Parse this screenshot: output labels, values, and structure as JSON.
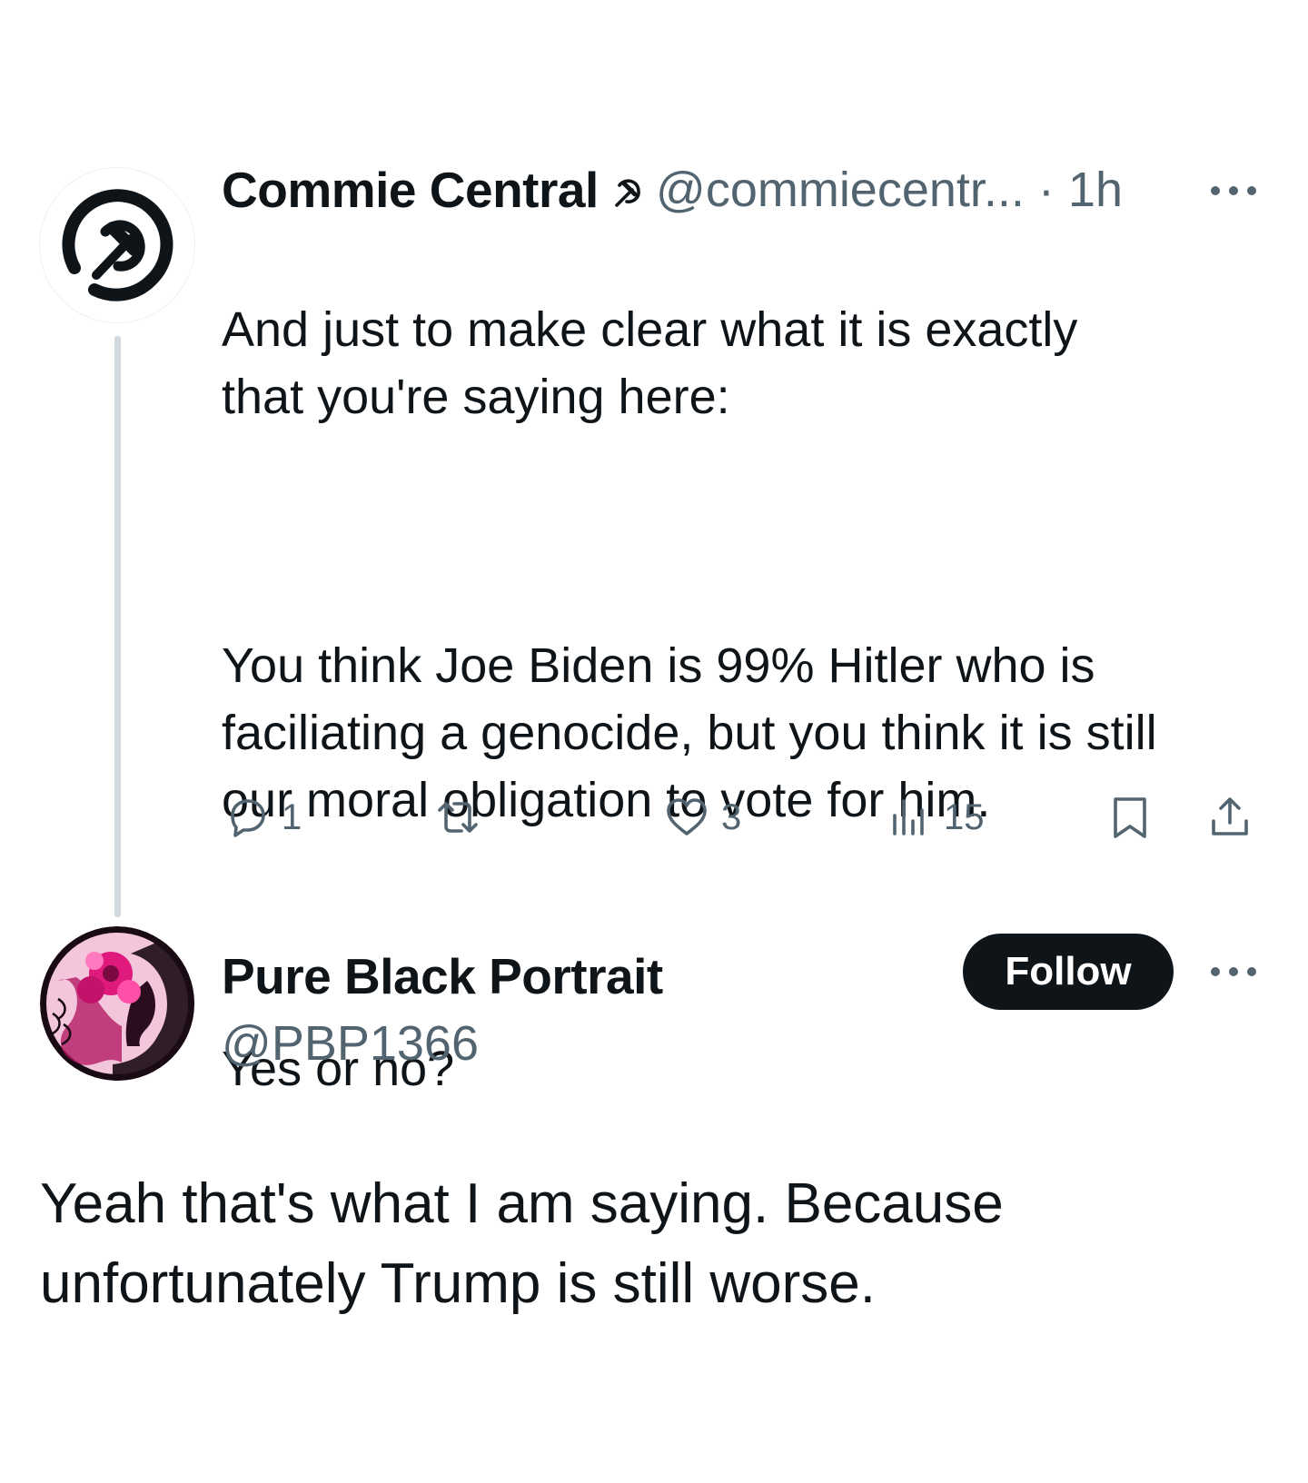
{
  "tweet": {
    "author_name": "Commie Central",
    "author_emoji": "☭",
    "handle_time": "@commiecentr... · 1h",
    "text_paragraphs": [
      "And just to make clear what it is exactly\nthat you're saying here:",
      "You think Joe Biden is 99% Hitler who is\nfaciliating a genocide, but you think it is still\nour moral obligation to vote for him.",
      "Yes or no?"
    ],
    "actions": {
      "replies": "1",
      "likes": "3",
      "views": "15"
    }
  },
  "reply": {
    "author_name": "Pure Black Portrait",
    "handle": "@PBP1366",
    "follow_label": "Follow",
    "text": "Yeah that's what I am saying. Because\nunfortunately Trump is still worse."
  },
  "colors": {
    "text_primary": "#0f1419",
    "text_secondary": "#536471",
    "thread_line": "#cfd9de",
    "follow_bg": "#0f1419",
    "avatar2_accent": "#e0197d"
  },
  "icons": {
    "avatar1": "hammer-sickle-logo",
    "more": "ellipsis-icon",
    "reply": "comment-icon",
    "retweet": "retweet-icon",
    "like": "heart-icon",
    "views": "views-chart-icon",
    "bookmark": "bookmark-icon",
    "share": "share-icon"
  }
}
